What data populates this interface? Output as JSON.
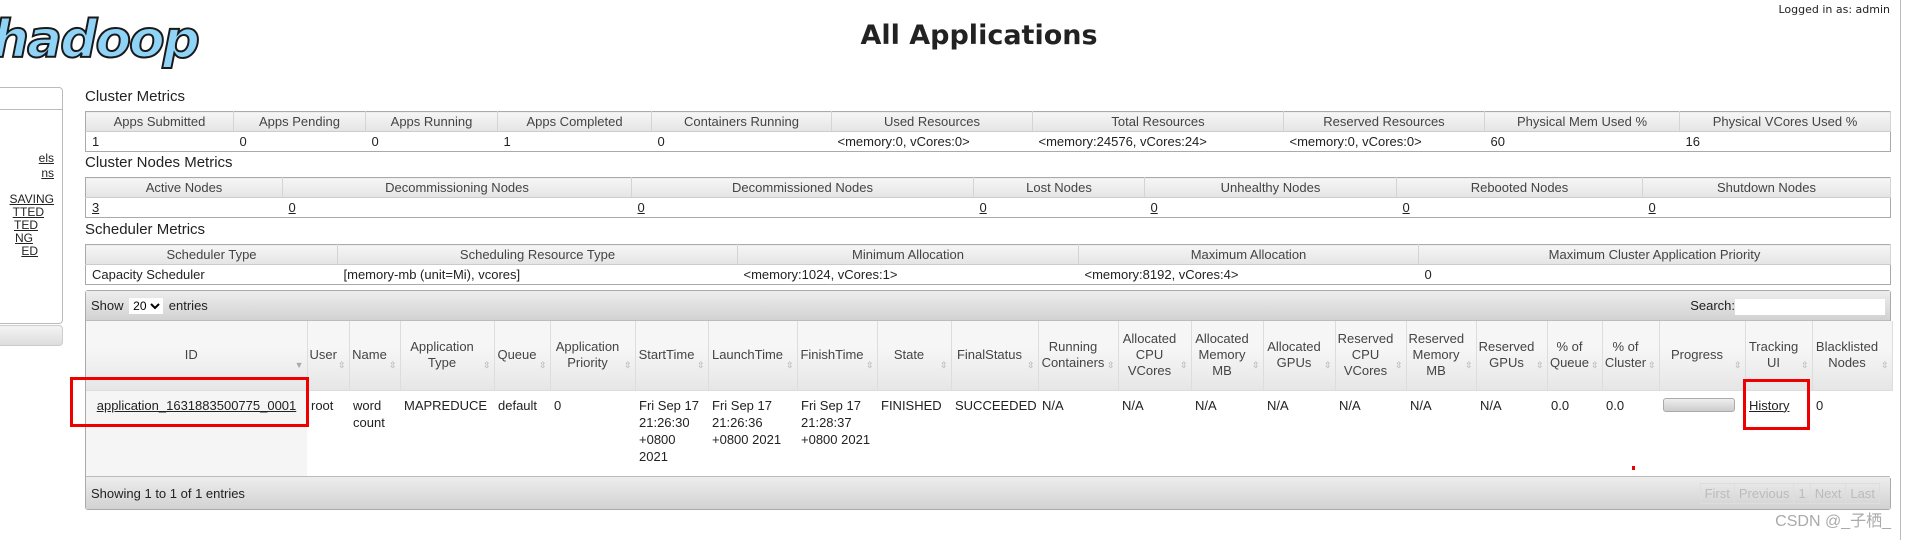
{
  "header": {
    "logo": "hadoop",
    "title": "All Applications",
    "logged_in": "Logged in as: admin"
  },
  "sidebar": {
    "link_fragments": [
      "els",
      "ns",
      "SAVING",
      "TTED",
      "TED",
      "NG",
      "ED"
    ]
  },
  "cluster_metrics": {
    "title": "Cluster Metrics",
    "headers": [
      "Apps Submitted",
      "Apps Pending",
      "Apps Running",
      "Apps Completed",
      "Containers Running",
      "Used Resources",
      "Total Resources",
      "Reserved Resources",
      "Physical Mem Used %",
      "Physical VCores Used %"
    ],
    "values": [
      "1",
      "0",
      "0",
      "1",
      "0",
      "<memory:0, vCores:0>",
      "<memory:24576, vCores:24>",
      "<memory:0, vCores:0>",
      "60",
      "16"
    ]
  },
  "cluster_nodes": {
    "title": "Cluster Nodes Metrics",
    "headers": [
      "Active Nodes",
      "Decommissioning Nodes",
      "Decommissioned Nodes",
      "Lost Nodes",
      "Unhealthy Nodes",
      "Rebooted Nodes",
      "Shutdown Nodes"
    ],
    "values": [
      "3",
      "0",
      "0",
      "0",
      "0",
      "0",
      "0"
    ]
  },
  "scheduler": {
    "title": "Scheduler Metrics",
    "headers": [
      "Scheduler Type",
      "Scheduling Resource Type",
      "Minimum Allocation",
      "Maximum Allocation",
      "Maximum Cluster Application Priority"
    ],
    "values": [
      "Capacity Scheduler",
      "[memory-mb (unit=Mi), vcores]",
      "<memory:1024, vCores:1>",
      "<memory:8192, vCores:4>",
      "0"
    ]
  },
  "apps": {
    "show_label": "Show",
    "page_size": "20",
    "entries_label": "entries",
    "search_label": "Search:",
    "search_value": "",
    "headers": [
      "ID",
      "User",
      "Name",
      "Application Type",
      "Queue",
      "Application Priority",
      "StartTime",
      "LaunchTime",
      "FinishTime",
      "State",
      "FinalStatus",
      "Running Containers",
      "Allocated CPU VCores",
      "Allocated Memory MB",
      "Allocated GPUs",
      "Reserved CPU VCores",
      "Reserved Memory MB",
      "Reserved GPUs",
      "% of Queue",
      "% of Cluster",
      "Progress",
      "Tracking UI",
      "Blacklisted Nodes"
    ],
    "rows": [
      {
        "id": "application_1631883500775_0001",
        "user": "root",
        "name": "word count",
        "type": "MAPREDUCE",
        "queue": "default",
        "priority": "0",
        "start": "Fri Sep 17 21:26:30 +0800 2021",
        "launch": "Fri Sep 17 21:26:36 +0800 2021",
        "finish": "Fri Sep 17 21:28:37 +0800 2021",
        "state": "FINISHED",
        "final_status": "SUCCEEDED",
        "running_containers": "N/A",
        "alloc_cpu": "N/A",
        "alloc_mem": "N/A",
        "alloc_gpu": "N/A",
        "res_cpu": "N/A",
        "res_mem": "N/A",
        "res_gpu": "N/A",
        "pct_queue": "0.0",
        "pct_cluster": "0.0",
        "progress": 0,
        "tracking": "History",
        "blacklisted": "0"
      }
    ],
    "info": "Showing 1 to 1 of 1 entries",
    "pager": [
      "First",
      "Previous",
      "1",
      "Next",
      "Last"
    ]
  },
  "watermark": "CSDN @_子栖_",
  "colors": {
    "highlight": "#ee0000",
    "logo": "#8fd3f7"
  }
}
